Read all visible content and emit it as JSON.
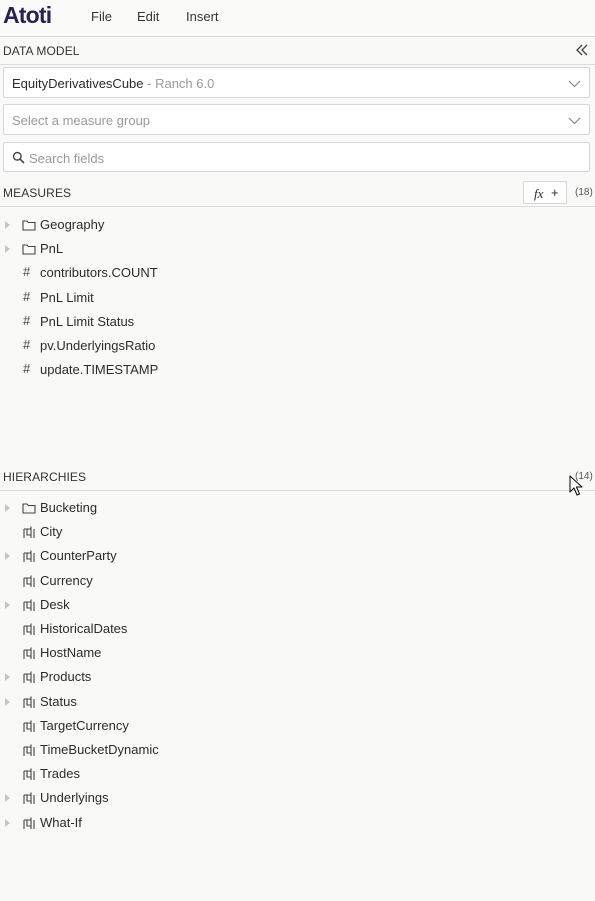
{
  "app": {
    "logo": "Atoti",
    "menu": [
      "File",
      "Edit",
      "Insert"
    ]
  },
  "data_model": {
    "title": "DATA MODEL",
    "cube_select": {
      "cube": "EquityDerivativesCube",
      "separator": " - ",
      "server": "Ranch 6.0"
    },
    "measure_group_select": {
      "placeholder": "Select a measure group"
    },
    "search": {
      "placeholder": "Search fields",
      "value": ""
    }
  },
  "measures": {
    "title": "MEASURES",
    "fx_label": "fx",
    "plus_label": "+",
    "count": "(18)",
    "items": [
      {
        "label": "Geography",
        "type": "folder",
        "expandable": true
      },
      {
        "label": "PnL",
        "type": "folder",
        "expandable": true
      },
      {
        "label": "contributors.COUNT",
        "type": "measure",
        "expandable": false
      },
      {
        "label": "PnL Limit",
        "type": "measure",
        "expandable": false
      },
      {
        "label": "PnL Limit Status",
        "type": "measure",
        "expandable": false
      },
      {
        "label": "pv.UnderlyingsRatio",
        "type": "measure",
        "expandable": false
      },
      {
        "label": "update.TIMESTAMP",
        "type": "measure",
        "expandable": false
      }
    ]
  },
  "hierarchies": {
    "title": "HIERARCHIES",
    "count": "(14)",
    "items": [
      {
        "label": "Bucketing",
        "type": "folder",
        "expandable": true
      },
      {
        "label": "City",
        "type": "hierarchy",
        "expandable": false
      },
      {
        "label": "CounterParty",
        "type": "hierarchy",
        "expandable": true
      },
      {
        "label": "Currency",
        "type": "hierarchy",
        "expandable": false
      },
      {
        "label": "Desk",
        "type": "hierarchy",
        "expandable": true
      },
      {
        "label": "HistoricalDates",
        "type": "hierarchy",
        "expandable": false
      },
      {
        "label": "HostName",
        "type": "hierarchy",
        "expandable": false
      },
      {
        "label": "Products",
        "type": "hierarchy",
        "expandable": true
      },
      {
        "label": "Status",
        "type": "hierarchy",
        "expandable": true
      },
      {
        "label": "TargetCurrency",
        "type": "hierarchy",
        "expandable": false
      },
      {
        "label": "TimeBucketDynamic",
        "type": "hierarchy",
        "expandable": false
      },
      {
        "label": "Trades",
        "type": "hierarchy",
        "expandable": false
      },
      {
        "label": "Underlyings",
        "type": "hierarchy",
        "expandable": true
      },
      {
        "label": "What-If",
        "type": "hierarchy",
        "expandable": true
      }
    ]
  },
  "colors": {
    "logo": "#262452",
    "background": "#f9f9f8",
    "border": "#dcdcdc",
    "muted_text": "#9a9a9a"
  },
  "icons": {
    "collapse": "double-chevron-left-icon",
    "dropdown": "chevron-down-icon",
    "search": "search-icon",
    "folder": "folder-icon",
    "measure": "hash-icon",
    "hierarchy": "hierarchy-icon"
  }
}
